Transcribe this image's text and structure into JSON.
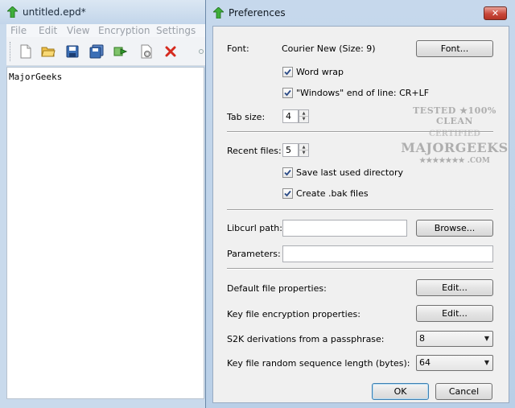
{
  "editor": {
    "title": "untitled.epd*",
    "menu": [
      "File",
      "Edit",
      "View",
      "Encryption",
      "Settings"
    ],
    "toolbar_icons": [
      "new-file-icon",
      "open-folder-icon",
      "save-icon",
      "save-all-icon",
      "export-icon",
      "settings-icon",
      "close-icon"
    ],
    "content": "MajorGeeks"
  },
  "dialog": {
    "title": "Preferences",
    "close_label": "✕",
    "font_label": "Font:",
    "font_value": "Courier New (Size: 9)",
    "font_button": "Font...",
    "word_wrap_label": "Word wrap",
    "eol_label": "\"Windows\" end of line: CR+LF",
    "tab_size_label": "Tab size:",
    "tab_size_value": "4",
    "recent_files_label": "Recent files:",
    "recent_files_value": "5",
    "save_dir_label": "Save last used directory",
    "bak_label": "Create .bak files",
    "libcurl_label": "Libcurl path:",
    "libcurl_value": "",
    "browse_button": "Browse...",
    "parameters_label": "Parameters:",
    "parameters_value": "",
    "default_props_label": "Default file properties:",
    "key_enc_label": "Key file encryption properties:",
    "edit_button": "Edit...",
    "s2k_label": "S2K derivations from a passphrase:",
    "s2k_value": "8",
    "key_len_label": "Key file random sequence length (bytes):",
    "key_len_value": "64",
    "ok_button": "OK",
    "cancel_button": "Cancel",
    "checkboxes": {
      "word_wrap": true,
      "eol": true,
      "save_dir": true,
      "bak": true
    }
  },
  "watermark": {
    "line1": "TESTED ★100% CLEAN",
    "line2": "CERTIFIED",
    "line3": "MAJORGEEKS",
    "line4": "★★★★★★★ .COM"
  }
}
